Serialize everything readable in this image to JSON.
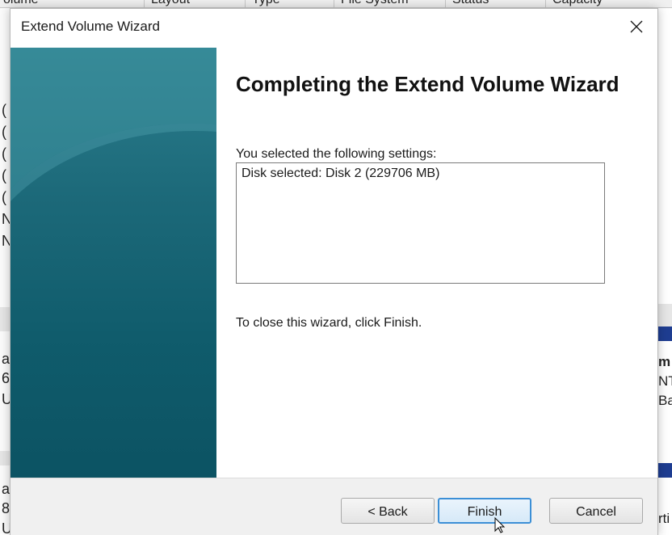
{
  "background": {
    "column_headers": [
      "olume",
      "Layout",
      "Type",
      "File System",
      "Status",
      "Capacity"
    ],
    "left_fragments": [
      "(",
      "(",
      "(",
      "(",
      "(",
      "N",
      "N",
      "as",
      "6",
      "Un",
      "as",
      "8",
      "Un"
    ],
    "right_fragments": [
      "m",
      "NT",
      "Bas",
      "rti"
    ]
  },
  "dialog": {
    "title": "Extend Volume Wizard",
    "heading": "Completing the Extend Volume Wizard",
    "settings_label": "You selected the following settings:",
    "settings_lines": [
      "Disk selected: Disk 2 (229706 MB)"
    ],
    "close_hint": "To close this wizard, click Finish.",
    "buttons": {
      "back": "< Back",
      "finish": "Finish",
      "cancel": "Cancel"
    }
  },
  "colors": {
    "side_panel": "#0f5b6b",
    "finish_border": "#3c8fd6",
    "stripe": "#1e3d91"
  },
  "icons": [
    "close-icon",
    "mouse-cursor-icon"
  ]
}
